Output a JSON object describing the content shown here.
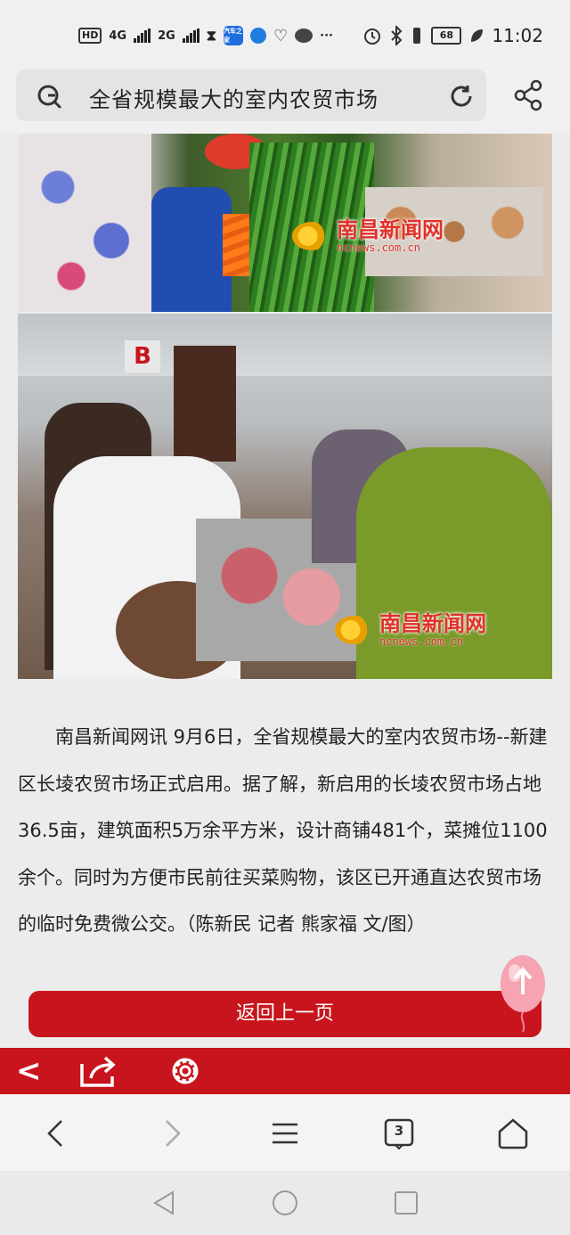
{
  "status_bar": {
    "hd": "HD",
    "net1": "4G",
    "net2": "2G",
    "app_badge": "汽车之家",
    "battery": "68",
    "time": "11:02",
    "more": "···"
  },
  "search": {
    "query": "全省规模最大的室内农贸市场"
  },
  "images": {
    "watermark_cn": "南昌新闻网",
    "watermark_en": "ncnews.com.cn",
    "stall_letter": "B"
  },
  "article": {
    "text": "南昌新闻网讯 9月6日，全省规模最大的室内农贸市场--新建区长堎农贸市场正式启用。据了解，新启用的长堎农贸市场占地36.5亩，建筑面积5万余平方米，设计商铺481个，菜摊位1100余个。同时为方便市民前往买菜购物，该区已开通直达农贸市场的临时免费微公交。（陈新民 记者 熊家福 文/图）"
  },
  "back_button": {
    "label": "返回上一页"
  },
  "toolbar": {
    "back": "<"
  },
  "browser_nav": {
    "tab_count": "3"
  },
  "colors": {
    "brand_red": "#c8141c",
    "watermark_red": "#e0312a"
  }
}
